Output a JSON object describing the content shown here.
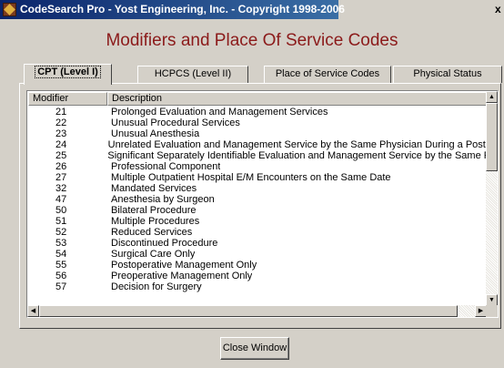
{
  "window": {
    "title": "CodeSearch Pro - Yost Engineering, Inc. - Copyright 1998-2006",
    "close_glyph": "x"
  },
  "heading": "Modifiers and Place Of Service Codes",
  "tabs": [
    {
      "label": "CPT (Level I)",
      "active": true
    },
    {
      "label": "HCPCS (Level II)",
      "active": false
    },
    {
      "label": "Place of Service Codes",
      "active": false
    },
    {
      "label": "Physical Status",
      "active": false
    }
  ],
  "table": {
    "columns": [
      "Modifier",
      "Description"
    ],
    "rows": [
      {
        "modifier": "21",
        "description": "Prolonged Evaluation and Management Services"
      },
      {
        "modifier": "22",
        "description": "Unusual Procedural Services"
      },
      {
        "modifier": "23",
        "description": "Unusual Anesthesia"
      },
      {
        "modifier": "24",
        "description": "Unrelated Evaluation and Management Service by the Same Physician During a Postopera"
      },
      {
        "modifier": "25",
        "description": "Significant Separately Identifiable Evaluation and Management Service by the Same Physic"
      },
      {
        "modifier": "26",
        "description": "Professional Component"
      },
      {
        "modifier": "27",
        "description": "Multiple Outpatient Hospital E/M Encounters on the Same Date"
      },
      {
        "modifier": "32",
        "description": "Mandated Services"
      },
      {
        "modifier": "47",
        "description": "Anesthesia by Surgeon"
      },
      {
        "modifier": "50",
        "description": "Bilateral Procedure"
      },
      {
        "modifier": "51",
        "description": "Multiple Procedures"
      },
      {
        "modifier": "52",
        "description": "Reduced Services"
      },
      {
        "modifier": "53",
        "description": "Discontinued Procedure"
      },
      {
        "modifier": "54",
        "description": "Surgical Care Only"
      },
      {
        "modifier": "55",
        "description": "Postoperative Management Only"
      },
      {
        "modifier": "56",
        "description": "Preoperative Management Only"
      },
      {
        "modifier": "57",
        "description": "Decision for Surgery"
      }
    ]
  },
  "buttons": {
    "close": "Close Window"
  },
  "colors": {
    "title_bar_start": "#0a246a",
    "title_bar_end": "#3a6ea5",
    "heading": "#8b1a1a",
    "face": "#d4d0c8"
  }
}
